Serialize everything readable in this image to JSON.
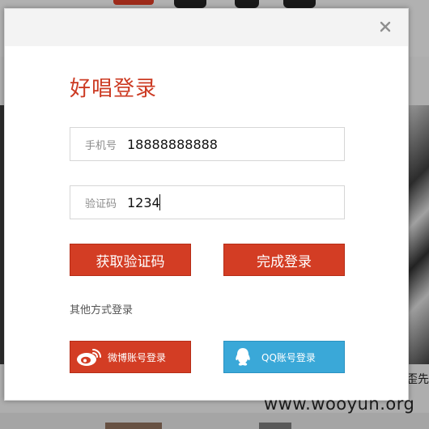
{
  "dialog": {
    "title": "好唱登录",
    "close_icon": "close-icon",
    "phone": {
      "label": "手机号",
      "value": "18888888888"
    },
    "code": {
      "label": "验证码",
      "value": "1234"
    },
    "get_code_label": "获取验证码",
    "login_label": "完成登录",
    "other_methods_label": "其他方式登录",
    "weibo": {
      "icon": "weibo-icon",
      "label": "微博账号登录"
    },
    "qq": {
      "icon": "qq-icon",
      "label": "QQ账号登录"
    }
  },
  "background": {
    "right_text": "歪先"
  },
  "watermark": "www.wooyun.org",
  "colors": {
    "accent": "#d33d24",
    "title": "#cc3a22",
    "qq": "#3aa8d8",
    "header_bg": "#f3f3f3"
  }
}
